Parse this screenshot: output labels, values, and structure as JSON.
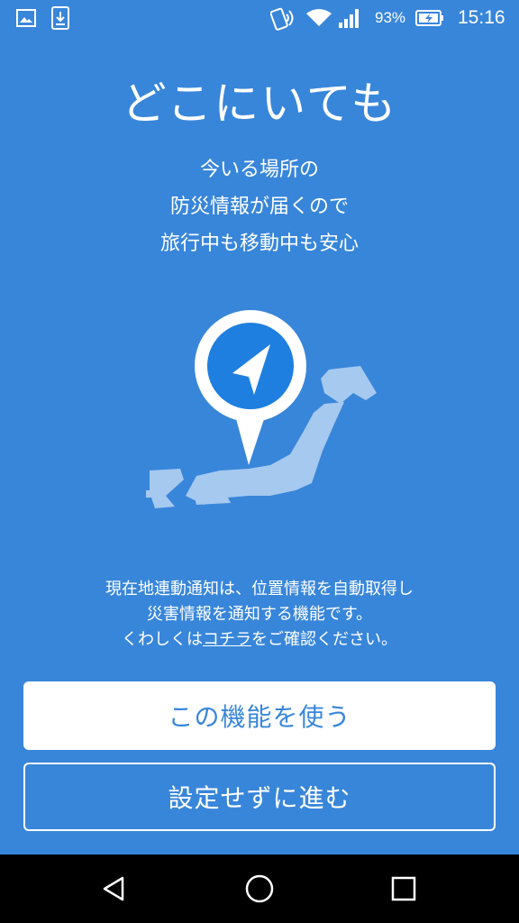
{
  "status_bar": {
    "battery_percent": "93%",
    "time": "15:16",
    "icons": [
      "image-icon",
      "download-icon",
      "nfc-icon",
      "wifi-icon",
      "signal-icon",
      "battery-charging-icon"
    ]
  },
  "onboarding": {
    "title": "どこにいても",
    "subtitle_lines": [
      "今いる場所の",
      "防災情報が届くので",
      "旅行中も移動中も安心"
    ],
    "description": {
      "line1": "現在地連動通知は、位置情報を自動取得し",
      "line2": "災害情報を通知する機能です。",
      "line3_prefix": "くわしくは",
      "line3_link": "コチラ",
      "line3_suffix": "をご確認ください。"
    },
    "use_button_label": "この機能を使う",
    "skip_button_label": "設定せずに進む"
  },
  "nav_bar": {
    "icons": [
      "back-icon",
      "home-icon",
      "recents-icon"
    ]
  },
  "colors": {
    "background": "#3886da",
    "pin_blue": "#1e7fe0",
    "map_light": "#a6c9ef",
    "nav_bar": "#000000"
  }
}
